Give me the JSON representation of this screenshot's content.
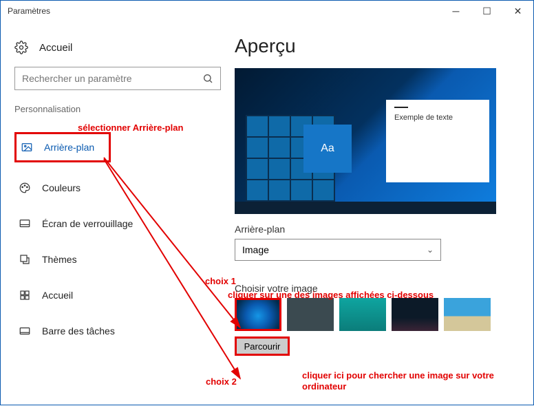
{
  "window": {
    "title": "Paramètres"
  },
  "sidebar": {
    "home": "Accueil",
    "search_placeholder": "Rechercher un paramètre",
    "section": "Personnalisation",
    "items": [
      {
        "label": "Arrière-plan",
        "active": true
      },
      {
        "label": "Couleurs"
      },
      {
        "label": "Écran de verrouillage"
      },
      {
        "label": "Thèmes"
      },
      {
        "label": "Accueil"
      },
      {
        "label": "Barre des tâches"
      }
    ]
  },
  "main": {
    "heading": "Aperçu",
    "preview_sample_text": "Exemple de texte",
    "preview_aa": "Aa",
    "bg_label": "Arrière-plan",
    "bg_value": "Image",
    "choose_label": "Choisir votre image",
    "browse": "Parcourir"
  },
  "annotations": {
    "select_bg": "sélectionner Arrière-plan",
    "choice1": "choix 1",
    "choice1_desc": "cliquer sur une des images affichées ci-dessous",
    "choice2": "choix 2",
    "choice2_desc": "cliquer ici pour chercher une image sur votre ordinateur"
  }
}
